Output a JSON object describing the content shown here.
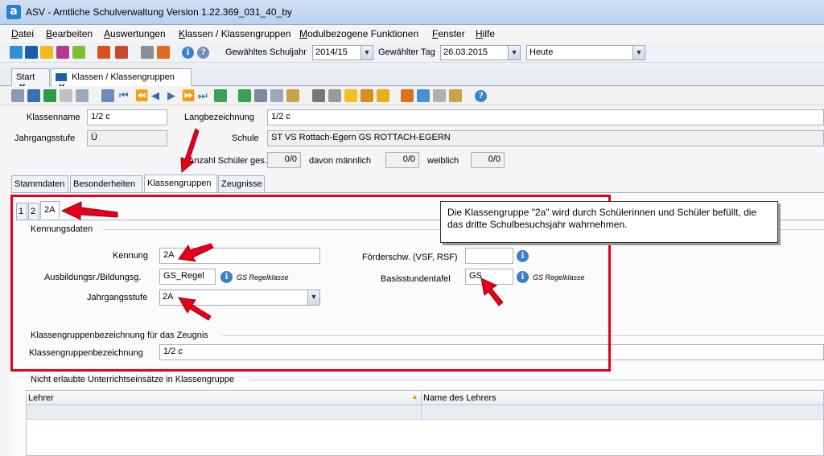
{
  "window": {
    "title": "ASV - Amtliche Schulverwaltung Version 1.22.369_031_40_by",
    "app_icon_letter": "a"
  },
  "menu": [
    "Datei",
    "Bearbeiten",
    "Auswertungen",
    "Klassen / Klassengruppen",
    "Modulbezogene Funktionen",
    "Fenster",
    "Hilfe"
  ],
  "toolbar": {
    "schuljahr_label": "Gewähltes Schuljahr",
    "schuljahr_value": "2014/15",
    "tag_label": "Gewählter Tag",
    "tag_value": "26.03.2015",
    "heute_value": "Heute"
  },
  "tabs": {
    "start": "Start",
    "klassen": "Klassen / Klassengruppen"
  },
  "form": {
    "klassenname_label": "Klassenname",
    "klassenname_value": "1/2 c",
    "langbezeichnung_label": "Langbezeichnung",
    "langbezeichnung_value": "1/2 c",
    "jahrgangsstufe_label": "Jahrgangsstufe",
    "jahrgangsstufe_value": "Ü",
    "schule_label": "Schule",
    "schule_value": "ST VS Rottach-Egern GS ROTTACH-EGERN",
    "anzahl_label": "Anzahl Schüler ges.",
    "anzahl_value": "0/0",
    "maennlich_label": "davon männlich",
    "maennlich_value": "0/0",
    "weiblich_label": "weiblich",
    "weiblich_value": "0/0"
  },
  "subtabs": [
    "Stammdaten",
    "Besonderheiten",
    "Klassengruppen",
    "Zeugnisse"
  ],
  "group_tabs": [
    "1",
    "2",
    "2A"
  ],
  "kennung_section": {
    "title": "Kennungsdaten",
    "kennung_label": "Kennung",
    "kennung_value": "2A",
    "ausbildung_label": "Ausbildungsr./Bildungsg.",
    "ausbildung_value": "GS_Regel",
    "ausbildung_hint": "GS Regelklasse",
    "jahrgangsstufe_label": "Jahrgangsstufe",
    "jahrgangsstufe_value": "2A",
    "foerder_label": "Förderschw. (VSF, RSF)",
    "foerder_value": "",
    "basis_label": "Basisstundentafel",
    "basis_value": "GS",
    "basis_hint": "GS Regelklasse"
  },
  "zeugnis_section": {
    "title": "Klassengruppenbezeichnung für das Zeugnis",
    "label": "Klassengruppenbezeichnung",
    "value": "1/2 c"
  },
  "unterricht_section": {
    "title": "Nicht erlaubte Unterrichtseinsätze in Klassengruppe",
    "columns": [
      "Lehrer",
      "Name des Lehrers"
    ]
  },
  "callout": "Die Klassengruppe \"2a\" wird durch Schülerinnen und Schüler befüllt, die das dritte Schulbesuchsjahr wahrnehmen.",
  "colors": {
    "annotation_red": "#e2001a",
    "accent_blue": "#3d7fcf"
  }
}
